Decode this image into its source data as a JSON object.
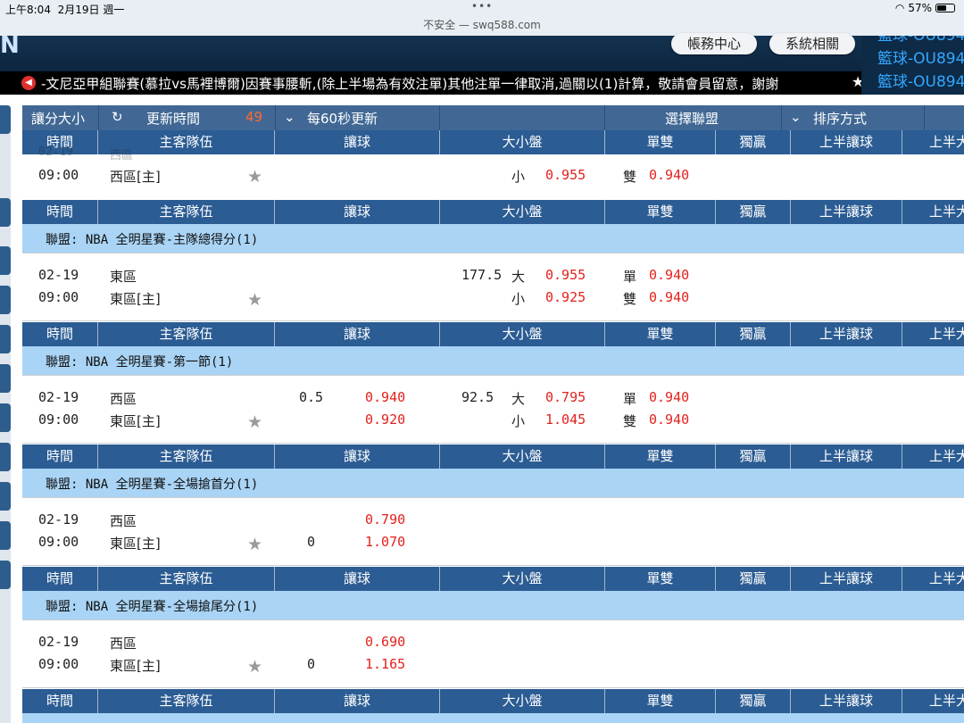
{
  "status": {
    "time": "上午8:04",
    "date": "2月19日 週一",
    "url": "不安全 — swq588.com",
    "battery": "57%",
    "dots": "•••"
  },
  "header": {
    "logo": "N",
    "buttons": [
      "帳務中心",
      "系統相關"
    ]
  },
  "side_panel": [
    "籃球-OU894",
    "籃球-OU894",
    "籃球-OU894"
  ],
  "ticker": {
    "text": "-文尼亞甲組聯賽(慕拉vs馬裡博爾)因賽事腰斬,(除上半場為有效注單)其他注單一律取消,過關以(1)計算，敬請會員留意，謝謝"
  },
  "toolbar": {
    "odds_size": "讓分大小",
    "refresh_label": "更新時間",
    "refresh_count": "49",
    "interval": "每60秒更新",
    "select_league": "選擇聯盟",
    "sort": "排序方式"
  },
  "columns": [
    "時間",
    "主客隊伍",
    "讓球",
    "大小盤",
    "單雙",
    "獨贏",
    "上半讓球",
    "上半大"
  ],
  "partial_row": {
    "time": "09:00",
    "team": "西區[主]",
    "ou_side": "小",
    "ou_odds": "0.955",
    "oe_side": "雙",
    "oe_odds": "0.940"
  },
  "sections": [
    {
      "league": "聯盟: NBA 全明星賽-主隊總得分(1)",
      "date": "02-19",
      "time": "09:00",
      "team1": "東區",
      "team2": "東區[主]",
      "hc_line1": "",
      "hc_odds1": "",
      "hc_line2": "",
      "hc_odds2": "",
      "ou_line": "177.5",
      "ou_side1": "大",
      "ou_odds1": "0.955",
      "ou_side2": "小",
      "ou_odds2": "0.925",
      "oe_side1": "單",
      "oe_odds1": "0.940",
      "oe_side2": "雙",
      "oe_odds2": "0.940"
    },
    {
      "league": "聯盟: NBA 全明星賽-第一節(1)",
      "date": "02-19",
      "time": "09:00",
      "team1": "西區",
      "team2": "東區[主]",
      "hc_line1": "0.5",
      "hc_odds1": "0.940",
      "hc_line2": "",
      "hc_odds2": "0.920",
      "ou_line": "92.5",
      "ou_side1": "大",
      "ou_odds1": "0.795",
      "ou_side2": "小",
      "ou_odds2": "1.045",
      "oe_side1": "單",
      "oe_odds1": "0.940",
      "oe_side2": "雙",
      "oe_odds2": "0.940"
    },
    {
      "league": "聯盟: NBA 全明星賽-全場搶首分(1)",
      "date": "02-19",
      "time": "09:00",
      "team1": "西區",
      "team2": "東區[主]",
      "hc_line1": "",
      "hc_odds1": "0.790",
      "hc_line2": "0",
      "hc_odds2": "1.070",
      "ou_line": "",
      "ou_side1": "",
      "ou_odds1": "",
      "ou_side2": "",
      "ou_odds2": "",
      "oe_side1": "",
      "oe_odds1": "",
      "oe_side2": "",
      "oe_odds2": ""
    },
    {
      "league": "聯盟: NBA 全明星賽-全場搶尾分(1)",
      "date": "02-19",
      "time": "09:00",
      "team1": "西區",
      "team2": "東區[主]",
      "hc_line1": "",
      "hc_odds1": "0.690",
      "hc_line2": "0",
      "hc_odds2": "1.165",
      "ou_line": "",
      "ou_side1": "",
      "ou_odds1": "",
      "ou_side2": "",
      "ou_odds2": "",
      "oe_side1": "",
      "oe_odds1": "",
      "oe_side2": "",
      "oe_odds2": ""
    }
  ]
}
